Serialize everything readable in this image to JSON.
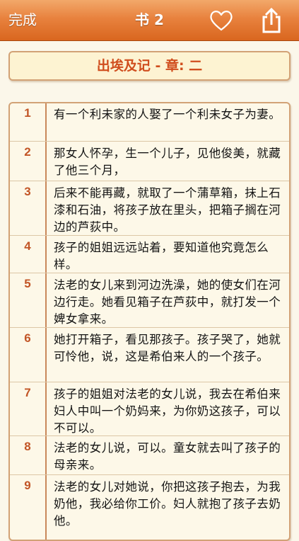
{
  "header": {
    "done_label": "完成",
    "title": "书 2",
    "favorite_icon": "heart-outline-icon",
    "share_icon": "share-icon",
    "bar_color": "#e8823e"
  },
  "chapter": {
    "title": "出埃及记 - 章: 二"
  },
  "verses": [
    {
      "num": "1",
      "text": "有一个利未家的人娶了一个利未女子为妻。"
    },
    {
      "num": "2",
      "text": "那女人怀孕，生一个儿子，见他俊美，就藏了他三个月，"
    },
    {
      "num": "3",
      "text": "后来不能再藏，就取了一个蒲草箱，抹上石漆和石油，将孩子放在里头，把箱子搁在河边的芦荻中。"
    },
    {
      "num": "4",
      "text": "孩子的姐姐远远站着，要知道他究竟怎么样。"
    },
    {
      "num": "5",
      "text": "法老的女儿来到河边洗澡，她的使女们在河边行走。她看见箱子在芦荻中，就打发一个婢女拿来。"
    },
    {
      "num": "6",
      "text": "她打开箱子，看见那孩子。孩子哭了，她就可怜他，说，这是希伯来人的一个孩子。"
    },
    {
      "num": "7",
      "text": "孩子的姐姐对法老的女儿说，我去在希伯来妇人中叫一个奶妈来，为你奶这孩子，可以不可以。"
    },
    {
      "num": "8",
      "text": "法老的女儿说，可以。童女就去叫了孩子的母亲来。"
    },
    {
      "num": "9",
      "text": "法老的女儿对她说，你把这孩子抱去，为我奶他，我必给你工价。妇人就抱了孩子去奶他。"
    }
  ]
}
